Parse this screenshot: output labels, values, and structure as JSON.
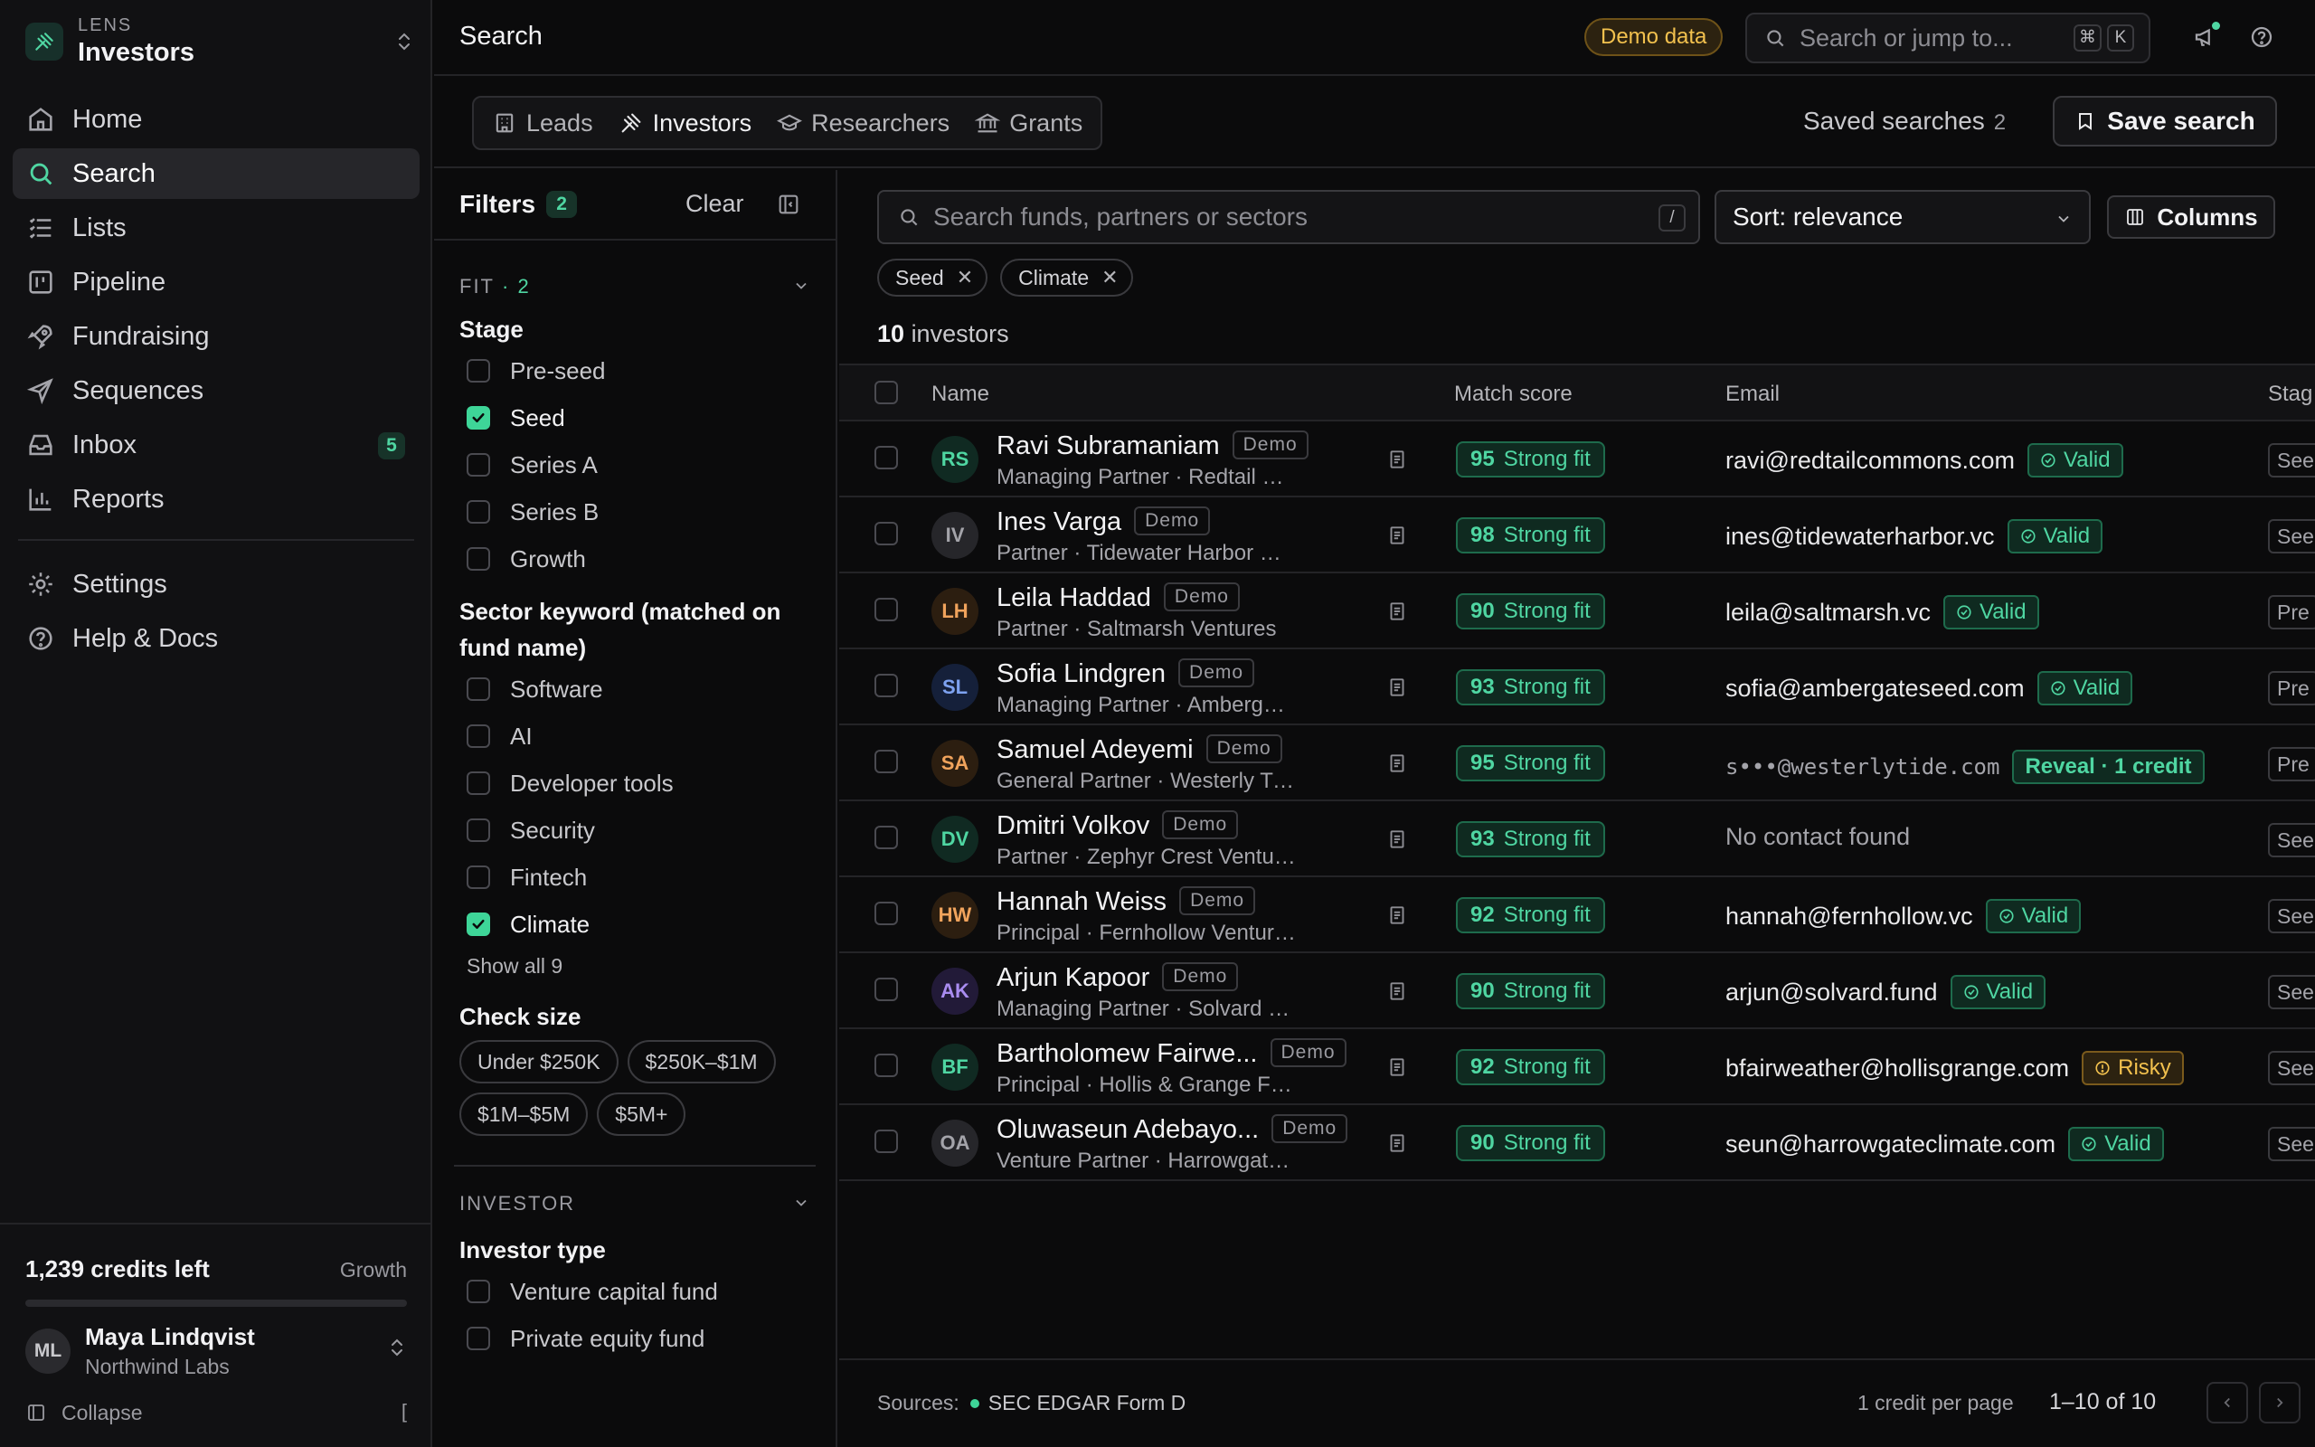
{
  "workspace": {
    "label": "LENS",
    "name": "Investors"
  },
  "nav": {
    "items": [
      {
        "label": "Home",
        "icon": "home-icon"
      },
      {
        "label": "Search",
        "icon": "search-icon",
        "active": true
      },
      {
        "label": "Lists",
        "icon": "list-icon"
      },
      {
        "label": "Pipeline",
        "icon": "pipeline-icon"
      },
      {
        "label": "Fundraising",
        "icon": "rocket-icon"
      },
      {
        "label": "Sequences",
        "icon": "send-icon"
      },
      {
        "label": "Inbox",
        "icon": "inbox-icon",
        "badge": "5"
      },
      {
        "label": "Reports",
        "icon": "chart-icon"
      }
    ],
    "secondary": [
      {
        "label": "Settings",
        "icon": "gear-icon"
      },
      {
        "label": "Help & Docs",
        "icon": "help-icon"
      }
    ]
  },
  "credits": {
    "left": "1,239 credits left",
    "plan": "Growth",
    "usage_fraction": 0.0
  },
  "user": {
    "initials": "ML",
    "name": "Maya Lindqvist",
    "org": "Northwind Labs"
  },
  "collapse": {
    "label": "Collapse",
    "shortcut": "["
  },
  "header": {
    "title": "Search",
    "demo_badge": "Demo data",
    "search_placeholder": "Search or jump to...",
    "kbd_cmd": "⌘",
    "kbd_k": "K"
  },
  "tabs": [
    {
      "label": "Leads",
      "icon": "building-icon"
    },
    {
      "label": "Investors",
      "icon": "investors-icon",
      "active": true
    },
    {
      "label": "Researchers",
      "icon": "graduation-cap-icon"
    },
    {
      "label": "Grants",
      "icon": "bank-icon"
    }
  ],
  "saved_searches": {
    "label": "Saved searches",
    "count": "2"
  },
  "save_search_label": "Save search",
  "filters": {
    "title": "Filters",
    "count": "2",
    "clear_label": "Clear",
    "fit_section": {
      "label": "FIT",
      "count": "· 2"
    },
    "stage": {
      "title": "Stage",
      "options": [
        {
          "label": "Pre-seed",
          "checked": false
        },
        {
          "label": "Seed",
          "checked": true
        },
        {
          "label": "Series A",
          "checked": false
        },
        {
          "label": "Series B",
          "checked": false
        },
        {
          "label": "Growth",
          "checked": false
        }
      ]
    },
    "sector": {
      "title": "Sector keyword (matched on fund name)",
      "options": [
        {
          "label": "Software",
          "checked": false
        },
        {
          "label": "AI",
          "checked": false
        },
        {
          "label": "Developer tools",
          "checked": false
        },
        {
          "label": "Security",
          "checked": false
        },
        {
          "label": "Fintech",
          "checked": false
        },
        {
          "label": "Climate",
          "checked": true
        }
      ],
      "show_all": "Show all 9"
    },
    "check_size": {
      "title": "Check size",
      "chips": [
        "Under $250K",
        "$250K–$1M",
        "$1M–$5M",
        "$5M+"
      ]
    },
    "investor_section": {
      "label": "INVESTOR"
    },
    "investor_type": {
      "title": "Investor type",
      "options": [
        {
          "label": "Venture capital fund",
          "checked": false
        },
        {
          "label": "Private equity fund",
          "checked": false
        }
      ]
    }
  },
  "results": {
    "search_placeholder": "Search funds, partners or sectors",
    "search_kbd": "/",
    "sort_label": "Sort: relevance",
    "columns_label": "Columns",
    "active_tags": [
      "Seed",
      "Climate"
    ],
    "count_number": "10",
    "count_label": "investors",
    "columns": {
      "name": "Name",
      "match": "Match score",
      "email": "Email",
      "stage": "Stag"
    },
    "demo_tag": "Demo",
    "rows": [
      {
        "initials": "RS",
        "name": "Ravi Subramaniam",
        "subtitle": "Managing Partner · Redtail Commons",
        "score": "95",
        "fit": "Strong fit",
        "email": "ravi@redtailcommons.com",
        "email_kind": "normal",
        "status": "Valid",
        "status_kind": "valid",
        "stage": "See",
        "avatar_bg": "#102a22",
        "avatar_fg": "#4fd6a2"
      },
      {
        "initials": "IV",
        "name": "Ines Varga",
        "subtitle": "Partner · Tidewater Harbor Capital",
        "score": "98",
        "fit": "Strong fit",
        "email": "ines@tidewaterharbor.vc",
        "email_kind": "normal",
        "status": "Valid",
        "status_kind": "valid",
        "stage": "See",
        "avatar_bg": "#26262a",
        "avatar_fg": "#a4a4aa"
      },
      {
        "initials": "LH",
        "name": "Leila Haddad",
        "subtitle": "Partner · Saltmarsh Ventures",
        "score": "90",
        "fit": "Strong fit",
        "email": "leila@saltmarsh.vc",
        "email_kind": "normal",
        "status": "Valid",
        "status_kind": "valid",
        "stage": "Pre",
        "avatar_bg": "#2c1e10",
        "avatar_fg": "#f0a35c"
      },
      {
        "initials": "SL",
        "name": "Sofia Lindgren",
        "subtitle": "Managing Partner · Ambergate Seed",
        "score": "93",
        "fit": "Strong fit",
        "email": "sofia@ambergateseed.com",
        "email_kind": "normal",
        "status": "Valid",
        "status_kind": "valid",
        "stage": "Pre",
        "avatar_bg": "#15203a",
        "avatar_fg": "#7ea2f0"
      },
      {
        "initials": "SA",
        "name": "Samuel Adeyemi",
        "subtitle": "General Partner · Westerly Tide Fund",
        "score": "95",
        "fit": "Strong fit",
        "email": "s•••@westerlytide.com",
        "email_kind": "masked",
        "status": "Reveal · 1 credit",
        "status_kind": "reveal",
        "stage": "Pre",
        "avatar_bg": "#2c1e10",
        "avatar_fg": "#f0a35c"
      },
      {
        "initials": "DV",
        "name": "Dmitri Volkov",
        "subtitle": "Partner · Zephyr Crest Ventures",
        "score": "93",
        "fit": "Strong fit",
        "email": "No contact found",
        "email_kind": "none",
        "status": "",
        "status_kind": "none",
        "stage": "See",
        "avatar_bg": "#102a22",
        "avatar_fg": "#4fd6a2"
      },
      {
        "initials": "HW",
        "name": "Hannah Weiss",
        "subtitle": "Principal · Fernhollow Ventures",
        "score": "92",
        "fit": "Strong fit",
        "email": "hannah@fernhollow.vc",
        "email_kind": "normal",
        "status": "Valid",
        "status_kind": "valid",
        "stage": "See",
        "avatar_bg": "#2c1e10",
        "avatar_fg": "#f0a35c"
      },
      {
        "initials": "AK",
        "name": "Arjun Kapoor",
        "subtitle": "Managing Partner · Solvard Climate",
        "score": "90",
        "fit": "Strong fit",
        "email": "arjun@solvard.fund",
        "email_kind": "normal",
        "status": "Valid",
        "status_kind": "valid",
        "stage": "See",
        "avatar_bg": "#221a38",
        "avatar_fg": "#a98cf0"
      },
      {
        "initials": "BF",
        "name": "Bartholomew Fairwe...",
        "subtitle": "Principal · Hollis & Grange Family Office",
        "score": "92",
        "fit": "Strong fit",
        "email": "bfairweather@hollisgrange.com",
        "email_kind": "normal",
        "status": "Risky",
        "status_kind": "risky",
        "stage": "See",
        "avatar_bg": "#102a22",
        "avatar_fg": "#4fd6a2"
      },
      {
        "initials": "OA",
        "name": "Oluwaseun Adebayo...",
        "subtitle": "Venture Partner · Harrowgate Climate",
        "score": "90",
        "fit": "Strong fit",
        "email": "seun@harrowgateclimate.com",
        "email_kind": "normal",
        "status": "Valid",
        "status_kind": "valid",
        "stage": "See",
        "avatar_bg": "#26262a",
        "avatar_fg": "#a4a4aa"
      }
    ]
  },
  "footer": {
    "sources_label": "Sources:",
    "source_name": "SEC EDGAR Form D",
    "per_page": "1 credit per page",
    "range": "1–10 of 10"
  },
  "colors": {
    "accent": "#3ed598",
    "warning": "#f2c14e"
  }
}
